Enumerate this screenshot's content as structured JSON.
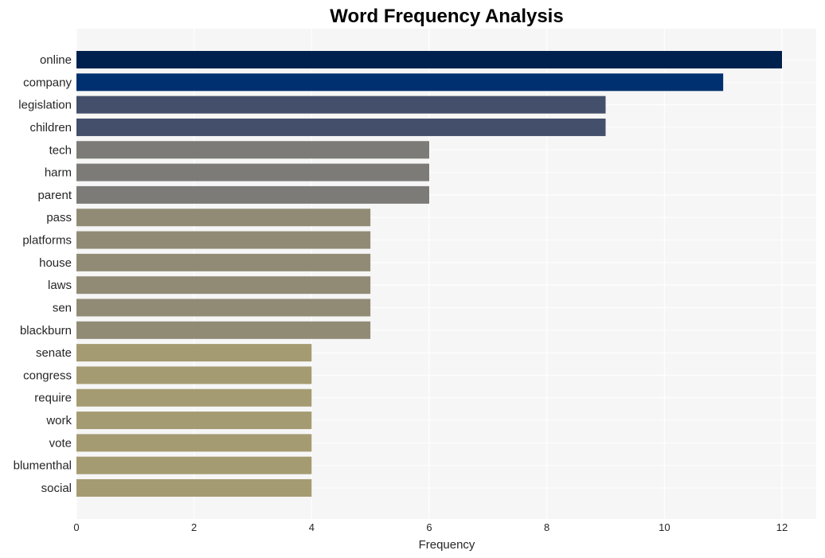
{
  "chart_data": {
    "type": "bar",
    "orientation": "horizontal",
    "title": "Word Frequency Analysis",
    "xlabel": "Frequency",
    "ylabel": "",
    "xlim": [
      0,
      12.6
    ],
    "xticks": [
      0,
      2,
      4,
      6,
      8,
      10,
      12
    ],
    "grid": true,
    "categories": [
      "online",
      "company",
      "legislation",
      "children",
      "tech",
      "harm",
      "parent",
      "pass",
      "platforms",
      "house",
      "laws",
      "sen",
      "blackburn",
      "senate",
      "congress",
      "require",
      "work",
      "vote",
      "blumenthal",
      "social"
    ],
    "values": [
      12,
      11,
      9,
      9,
      6,
      6,
      6,
      5,
      5,
      5,
      5,
      5,
      5,
      4,
      4,
      4,
      4,
      4,
      4,
      4
    ],
    "colors": [
      "#00214d",
      "#00306f",
      "#444f6b",
      "#444f6b",
      "#7c7b77",
      "#7c7b77",
      "#7c7b77",
      "#918b76",
      "#918b76",
      "#918b76",
      "#918b76",
      "#918b76",
      "#918b76",
      "#a59b72",
      "#a59b72",
      "#a59b72",
      "#a59b72",
      "#a59b72",
      "#a59b72",
      "#a59b72"
    ],
    "background": "#f6f6f6"
  }
}
